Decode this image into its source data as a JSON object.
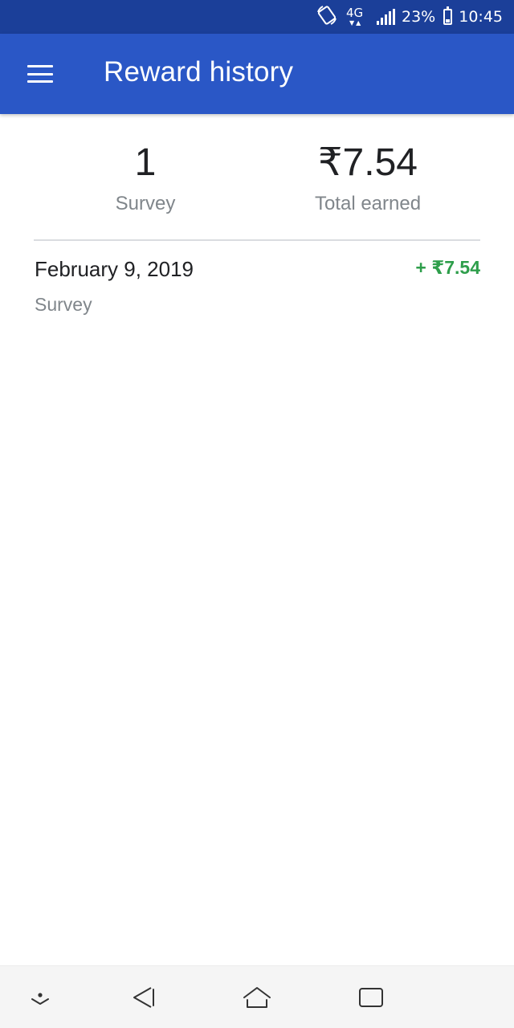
{
  "status_bar": {
    "network": "4G",
    "battery": "23%",
    "time": "10:45",
    "icons": [
      "rotate-icon",
      "network-4g-icon",
      "signal-icon",
      "battery-icon"
    ]
  },
  "app_bar": {
    "title": "Reward history",
    "background": "#2a57c6",
    "menu_icon": "hamburger-menu-icon"
  },
  "summary": {
    "count": "1",
    "count_label": "Survey",
    "total": "₹7.54",
    "total_label": "Total earned"
  },
  "history": [
    {
      "date": "February 9, 2019",
      "type": "Survey",
      "amount": "+ ₹7.54",
      "amount_color": "#2e9e4b"
    }
  ],
  "nav_bar": {
    "buttons": [
      "collapse-icon",
      "back-icon",
      "home-icon",
      "recents-icon"
    ]
  }
}
